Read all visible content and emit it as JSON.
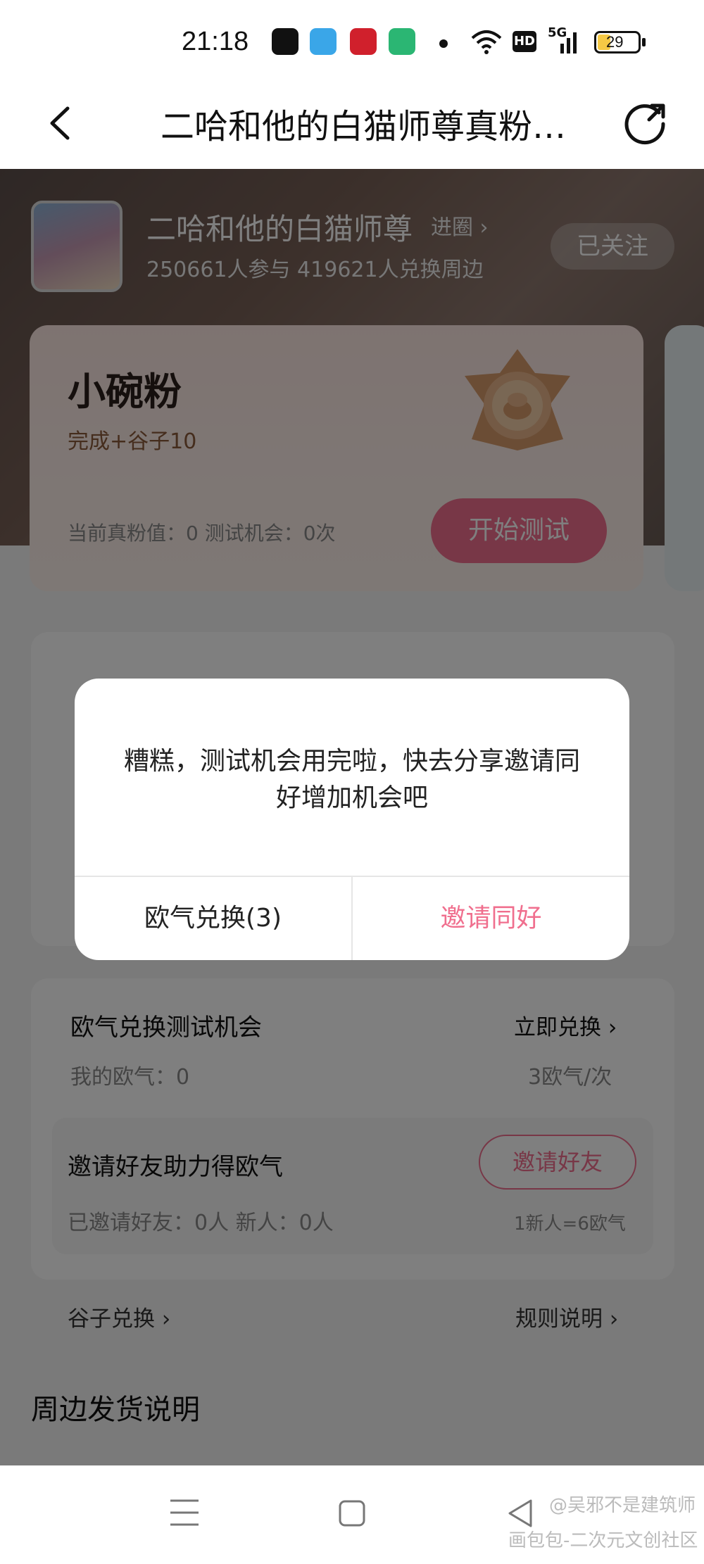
{
  "status_bar": {
    "time": "21:18",
    "icons": [
      "douyin-icon",
      "telegram-icon",
      "xuexi-icon",
      "app-icon",
      "dot-icon",
      "wifi-icon",
      "hd-icon",
      "signal-5g-icon",
      "battery-icon"
    ],
    "hd": "HD",
    "signal": "5G",
    "battery": "29"
  },
  "nav": {
    "title": "二哈和他的白猫师尊真粉…"
  },
  "circle": {
    "name": "二哈和他的白猫师尊",
    "enter_label": "进圈",
    "stats": "250661人参与    419621人兑换周边",
    "follow_label": "已关注"
  },
  "level_card": {
    "level_name": "小碗粉",
    "reward": "完成+谷子10",
    "current": "当前真粉值：0    测试机会：0次",
    "start_label": "开始测试"
  },
  "exchange_panel": {
    "title": "欧气兑换测试机会",
    "action": "立即兑换",
    "my_ouqi": "我的欧气：0",
    "rate": "3欧气/次"
  },
  "invite_panel": {
    "title": "邀请好友助力得欧气",
    "button": "邀请好友",
    "invited": "已邀请好友：0人    新人：0人",
    "rate": "1新人=6欧气"
  },
  "links": {
    "gu_exchange": "谷子兑换",
    "rules": "规则说明"
  },
  "shipping": {
    "title": "周边发货说明"
  },
  "dialog": {
    "message": "糟糕，测试机会用完啦，快去分享邀请同好增加机会吧",
    "left_button": "欧气兑换(3)",
    "right_button": "邀请同好"
  },
  "watermark": {
    "line1": "@吴邪不是建筑师",
    "line2": "画包包-二次元文创社区"
  },
  "colors": {
    "accent_pink": "#f06f8e",
    "overlay": "rgba(0,0,0,0.5)"
  }
}
